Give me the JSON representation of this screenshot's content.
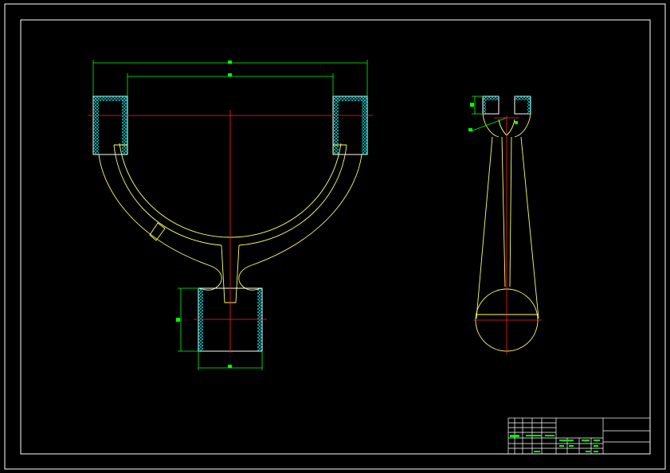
{
  "drawing": {
    "background": "#000000",
    "colors": {
      "frame": "#ffffff",
      "outline": "#ffff66",
      "centerline": "#ff2020",
      "dimension": "#00ff00",
      "hatch": "#00ffff",
      "title_block": "#ffffff"
    },
    "views": [
      {
        "name": "front-view-fork"
      },
      {
        "name": "side-view-connecting-rod"
      }
    ]
  },
  "title_block": {
    "rows": 7,
    "note": ""
  }
}
